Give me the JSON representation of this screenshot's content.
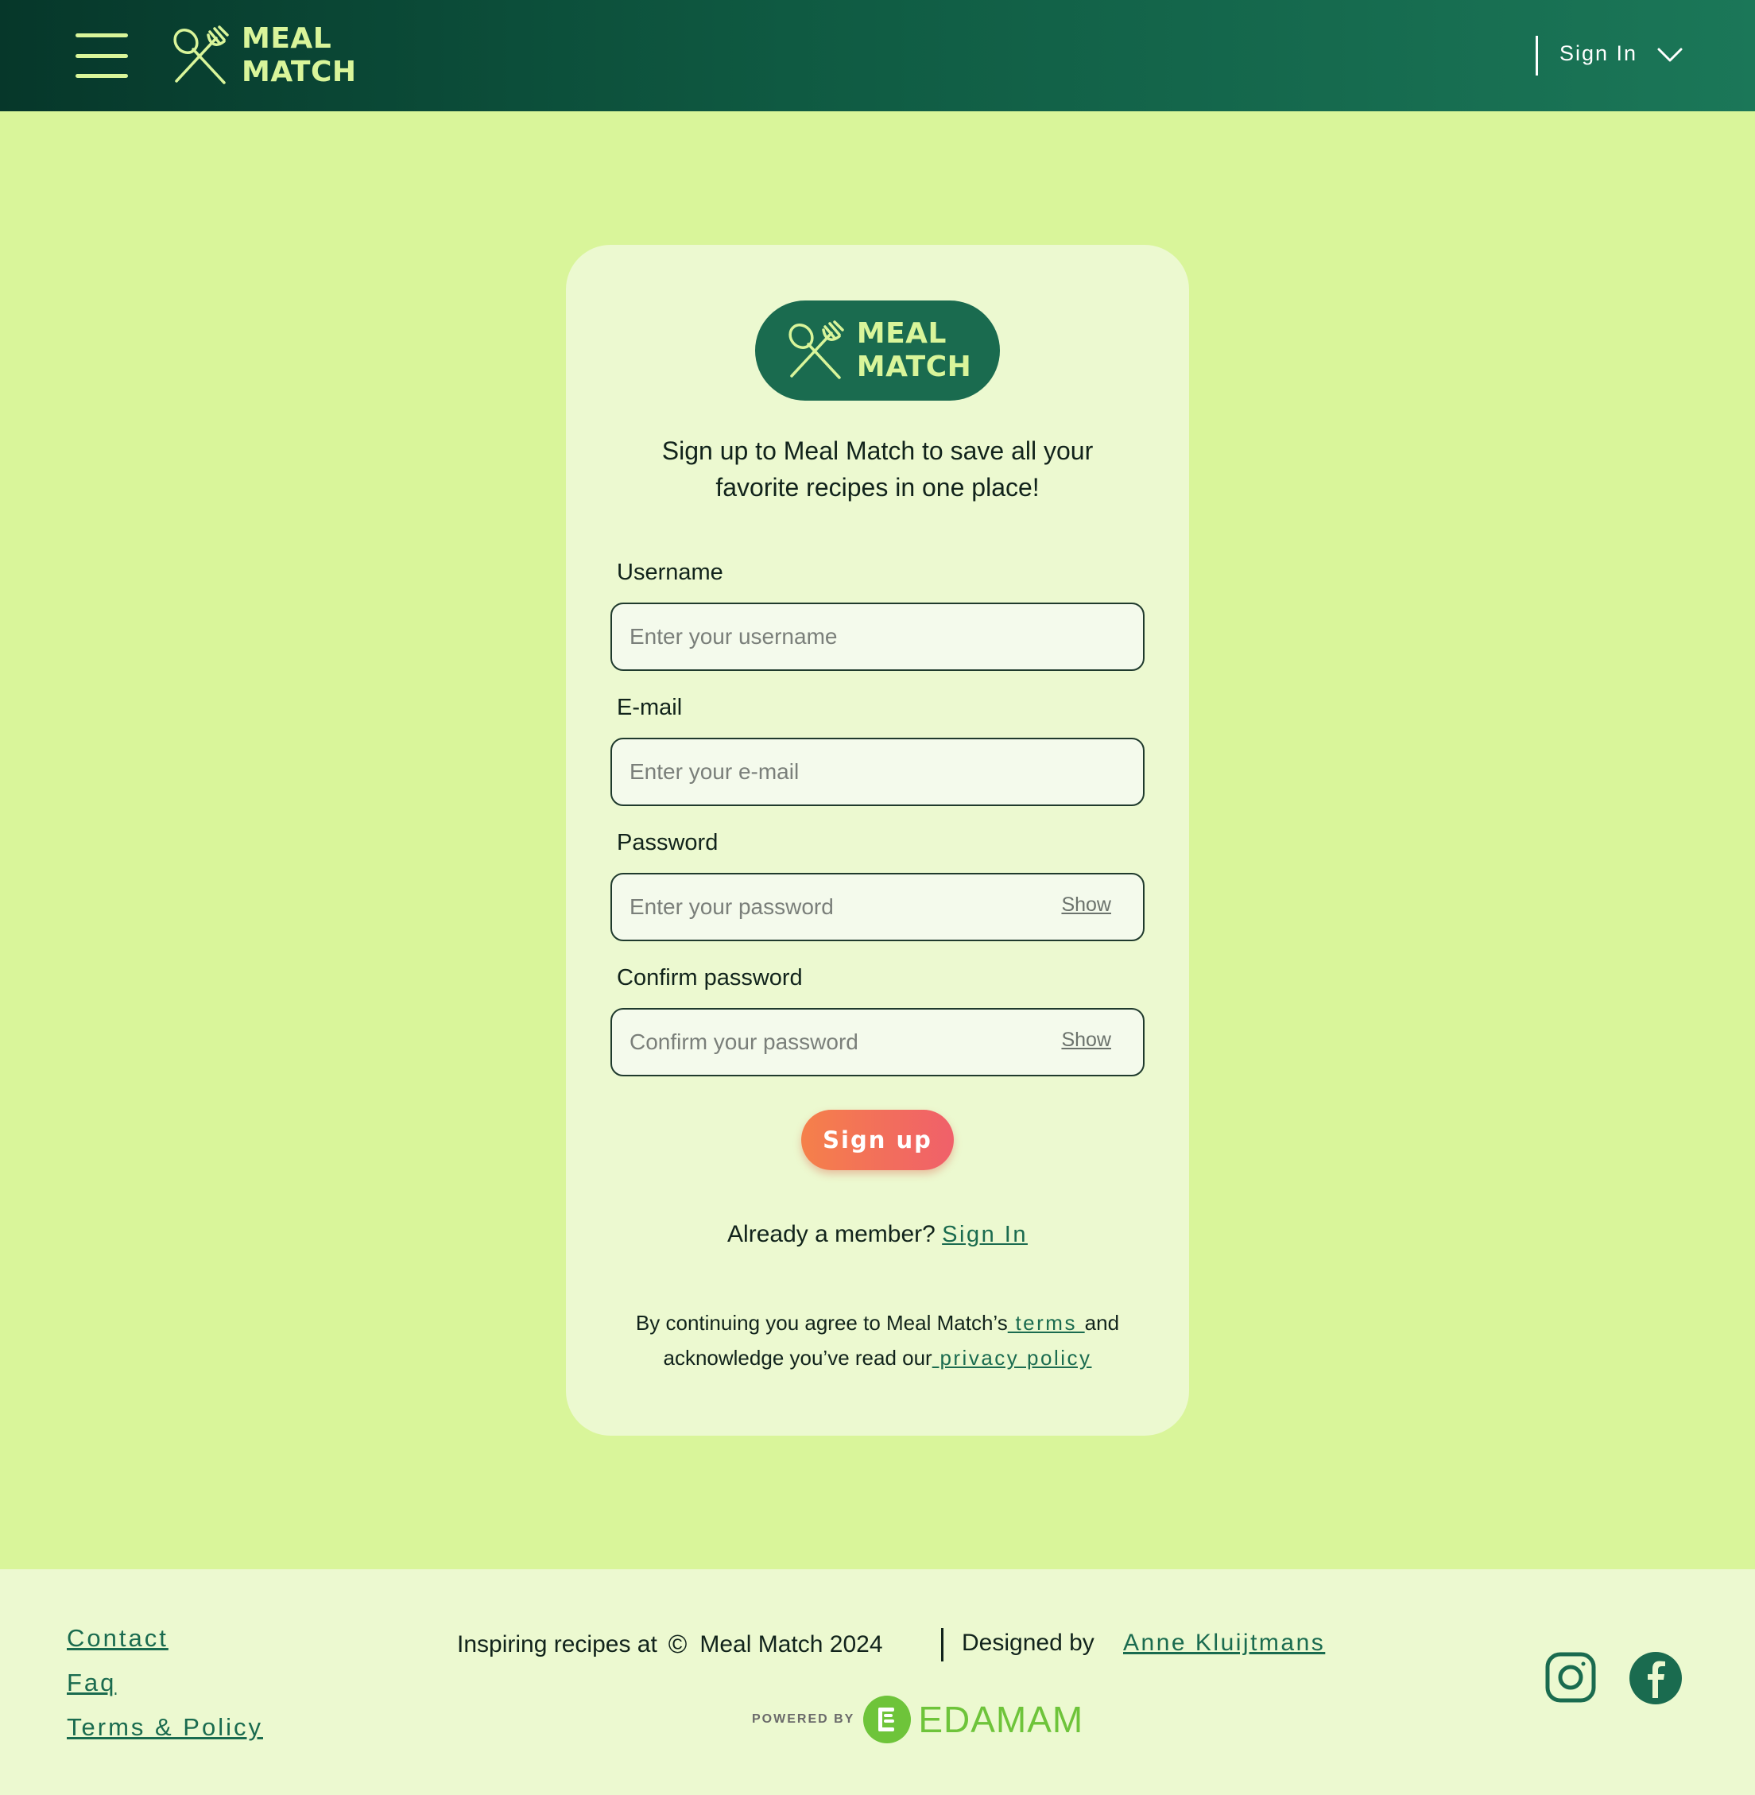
{
  "header": {
    "menu_icon": "hamburger-menu-icon",
    "logo": {
      "line1": "MEAL",
      "line2": "MATCH",
      "icon": "spoon-fork-icon"
    },
    "signin_label": "Sign In",
    "dropdown_icon": "chevron-down-icon"
  },
  "card": {
    "badge": {
      "line1": "MEAL",
      "line2": "MATCH"
    },
    "intro_line1": "Sign up to Meal Match to save all your",
    "intro_line2": "favorite recipes in one place!",
    "fields": {
      "username": {
        "label": "Username",
        "placeholder": "Enter your username"
      },
      "email": {
        "label": "E-mail",
        "placeholder": "Enter your e-mail"
      },
      "password": {
        "label": "Password",
        "placeholder": "Enter your password",
        "toggle": "Show"
      },
      "confirm": {
        "label": "Confirm password",
        "placeholder": "Confirm your password",
        "toggle": "Show"
      }
    },
    "signup_label": "Sign up",
    "member_text": "Already a member? ",
    "member_link": "Sign In",
    "legal_prefix": "By continuing you agree to Meal Match’s",
    "legal_terms": " terms ",
    "legal_mid": "and",
    "legal_line2_prefix": "acknowledge you’ve read our",
    "legal_privacy": " privacy policy"
  },
  "footer": {
    "links": [
      "Contact",
      "Faq",
      "Terms & Policy"
    ],
    "copyright_prefix": "Inspiring recipes at",
    "copyright_symbol": "©",
    "copyright_suffix": "Meal Match 2024",
    "designed_by": "Designed by",
    "designer": "Anne Kluijtmans",
    "powered_by": "POWERED BY",
    "edamam": "EDAMAM",
    "social_icons": [
      "instagram-icon",
      "facebook-icon"
    ]
  },
  "colors": {
    "background": "#d9f59a",
    "card": "#ecf9d0",
    "header_dark": "#06372a",
    "brand_green": "#1a6b4f",
    "accent_lime": "#d9f59a",
    "button_start": "#f5804a",
    "button_end": "#f0606a",
    "edamam_green": "#6ec43a"
  }
}
